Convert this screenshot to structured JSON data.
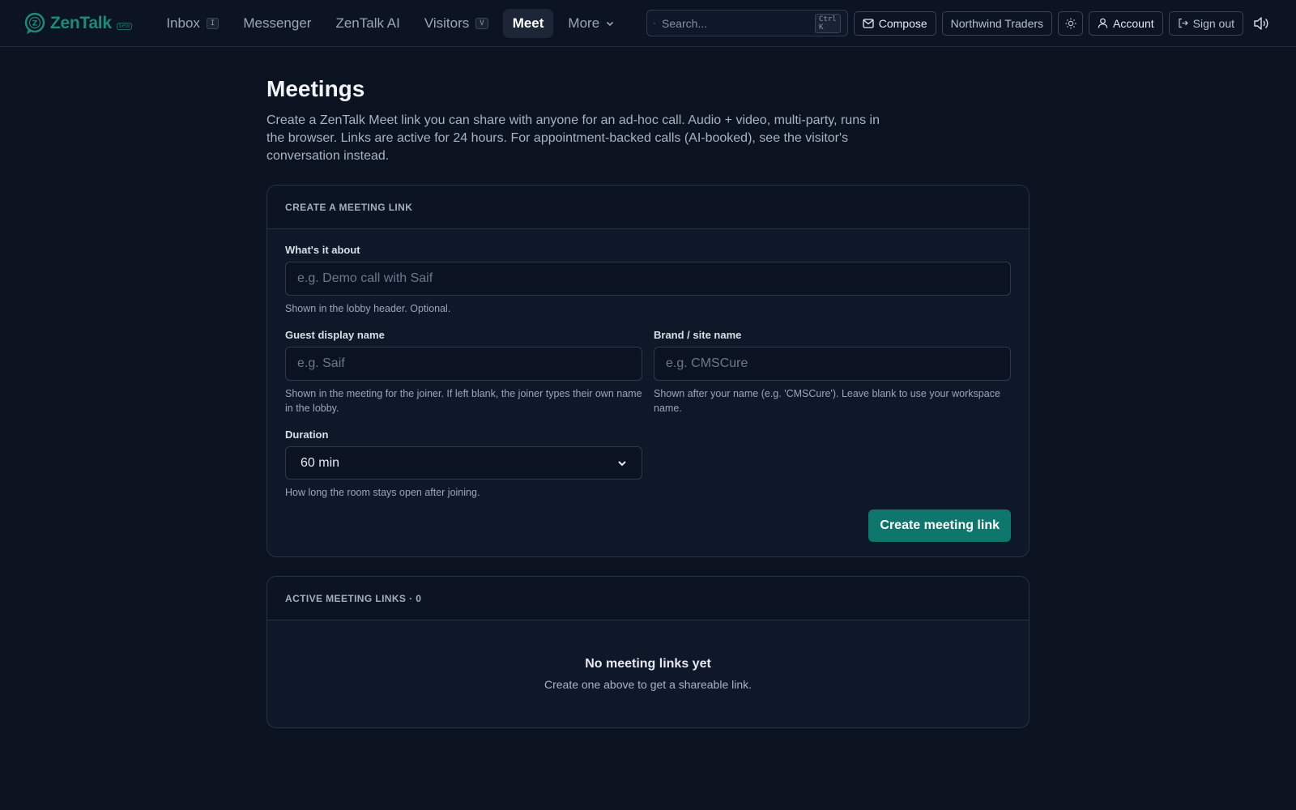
{
  "brand": {
    "name": "ZenTalk",
    "badge": "beta",
    "accent": "#1f8a7a"
  },
  "nav": {
    "items": [
      {
        "label": "Inbox",
        "kbd": "I"
      },
      {
        "label": "Messenger"
      },
      {
        "label": "ZenTalk AI"
      },
      {
        "label": "Visitors",
        "kbd": "V"
      },
      {
        "label": "Meet",
        "active": true
      },
      {
        "label": "More"
      }
    ],
    "search": {
      "placeholder": "Search...",
      "shortcut": "Ctrl K"
    },
    "compose": "Compose",
    "workspace": "Northwind Traders",
    "account": "Account",
    "signout": "Sign out"
  },
  "page": {
    "title": "Meetings",
    "description": "Create a ZenTalk Meet link you can share with anyone for an ad-hoc call. Audio + video, multi-party, runs in the browser. Links are active for 24 hours. For appointment-backed calls (AI-booked), see the visitor's conversation instead."
  },
  "create_card": {
    "heading": "CREATE A MEETING LINK",
    "about": {
      "label": "What's it about",
      "placeholder": "e.g. Demo call with Saif",
      "help": "Shown in the lobby header. Optional."
    },
    "guest": {
      "label": "Guest display name",
      "placeholder": "e.g. Saif",
      "help": "Shown in the meeting for the joiner. If left blank, the joiner types their own name in the lobby."
    },
    "brand": {
      "label": "Brand / site name",
      "placeholder": "e.g. CMSCure",
      "help": "Shown after your name (e.g. 'CMSCure'). Leave blank to use your workspace name."
    },
    "duration": {
      "label": "Duration",
      "value": "60 min",
      "help": "How long the room stays open after joining."
    },
    "submit": "Create meeting link"
  },
  "active_card": {
    "heading": "ACTIVE MEETING LINKS · 0",
    "empty_title": "No meeting links yet",
    "empty_sub": "Create one above to get a shareable link."
  }
}
